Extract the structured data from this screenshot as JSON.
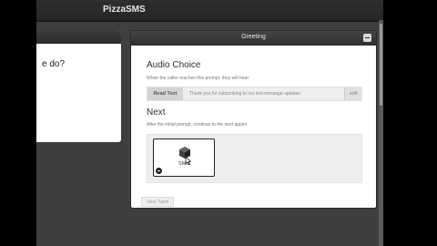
{
  "app": {
    "title": "PizzaSMS"
  },
  "left_card": {
    "text": "e do?"
  },
  "panel": {
    "title": "Greeting",
    "audio_choice": {
      "title": "Audio Choice",
      "description": "When the caller reaches this prompt, they will hear:",
      "mode_label": "Read Text",
      "prompt_text": "Thank you for subscribing to our text message updates",
      "edit_label": "edit"
    },
    "next": {
      "title": "Next",
      "description": "After the initial prompt, continue to the next applet",
      "applet_label": "SMS"
    },
    "view_twiml_label": "View Twiml"
  },
  "colors": {
    "header": "#2e2e2e",
    "background": "#3f3f3f"
  },
  "icons": [
    "collapse-icon",
    "sms-applet-icon",
    "remove-icon",
    "cursor-icon"
  ]
}
